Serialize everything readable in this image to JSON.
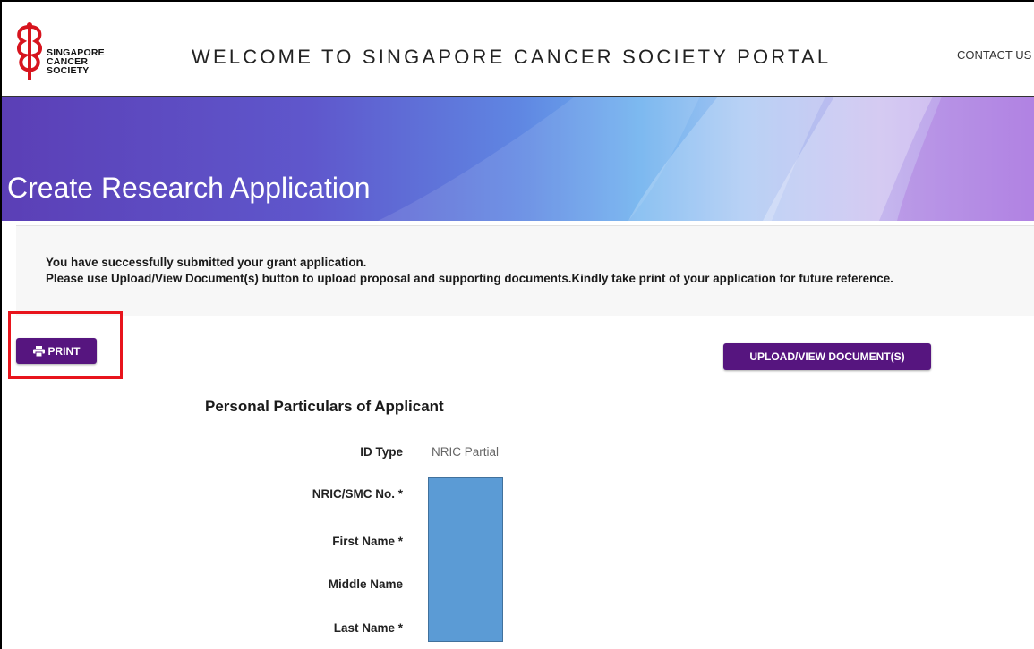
{
  "header": {
    "logo_lines": [
      "SINGAPORE",
      "CANCER",
      "SOCIETY"
    ],
    "title": "WELCOME TO SINGAPORE CANCER SOCIETY PORTAL",
    "contact_label": "CONTACT US"
  },
  "banner": {
    "page_title": "Create Research Application"
  },
  "notice": {
    "line1": "You have successfully submitted your grant application.",
    "line2": "Please use Upload/View Document(s) button to upload proposal and supporting documents.Kindly take print of your application for future reference."
  },
  "actions": {
    "print_label": "PRINT",
    "print_icon": "print-icon",
    "upload_label": "UPLOAD/VIEW DOCUMENT(S)"
  },
  "form": {
    "section_title": "Personal Particulars of Applicant",
    "fields": [
      {
        "label": "ID Type",
        "value": "NRIC Partial"
      },
      {
        "label": "NRIC/SMC No. *",
        "value": ""
      },
      {
        "label": "First Name *",
        "value": ""
      },
      {
        "label": "Middle Name",
        "value": ""
      },
      {
        "label": "Last Name *",
        "value": ""
      }
    ]
  },
  "colors": {
    "button_purple": "#56157f",
    "highlight_red": "#e8141c",
    "redaction_blue": "#5b9bd5",
    "logo_red": "#d7141e"
  }
}
